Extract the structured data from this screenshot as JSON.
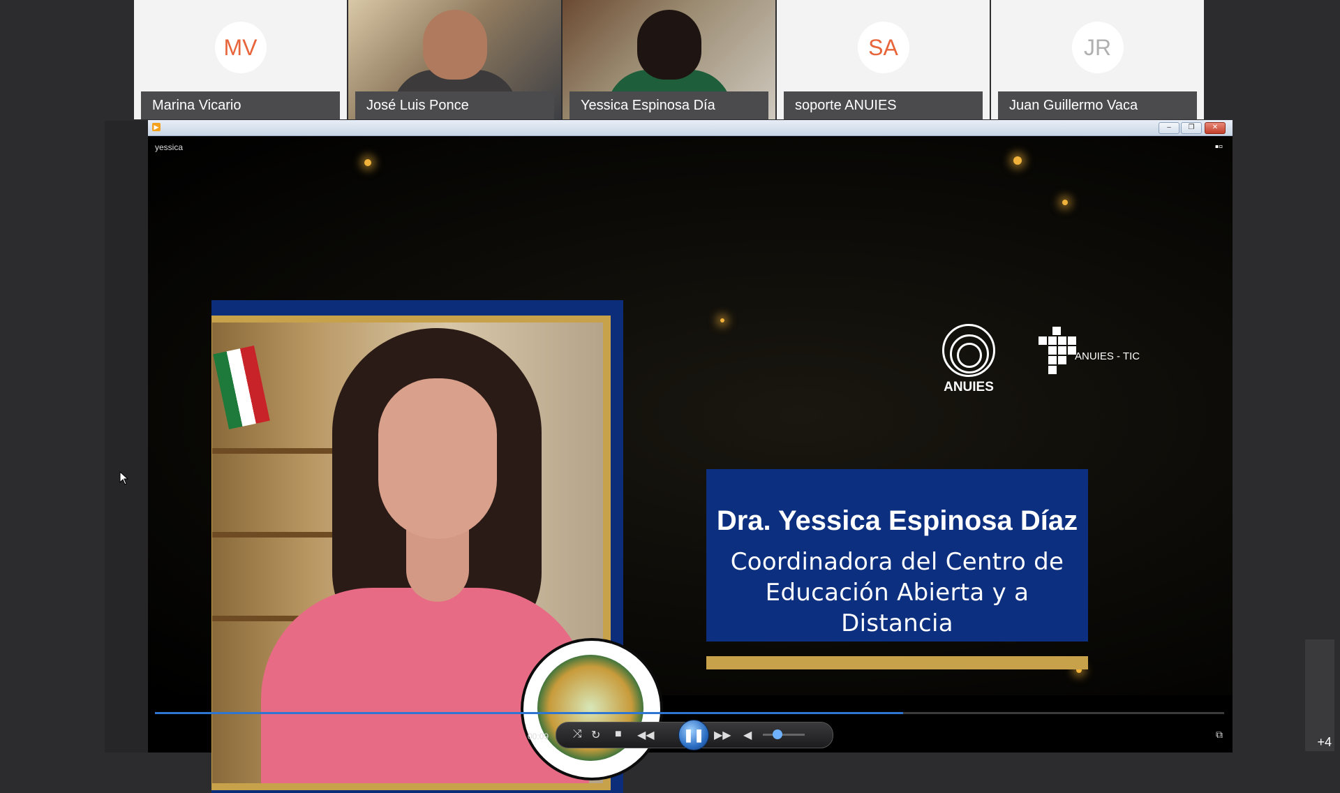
{
  "participants": [
    {
      "initials": "MV",
      "name": "Marina Vicario",
      "initials_color": "#e8643a"
    },
    {
      "initials": "",
      "name": "José Luis Ponce"
    },
    {
      "initials": "",
      "name": "Yessica Espinosa Día"
    },
    {
      "initials": "SA",
      "name": "soporte ANUIES",
      "initials_color": "#e8643a"
    },
    {
      "initials": "JR",
      "name": "Juan Guillermo Vaca",
      "initials_color": "#b0b0b0"
    }
  ],
  "player": {
    "file_label": "yessica",
    "time": "00:09",
    "progress": 0.7
  },
  "video": {
    "doctor_name": "Dra. Yessica Espinosa Díaz",
    "role_line1": "Coordinadora del Centro de",
    "role_line2": "Educación Abierta y a Distancia",
    "logo1": "ANUIES",
    "logo2": "ANUIES - TIC"
  },
  "overflow_count": "+4"
}
